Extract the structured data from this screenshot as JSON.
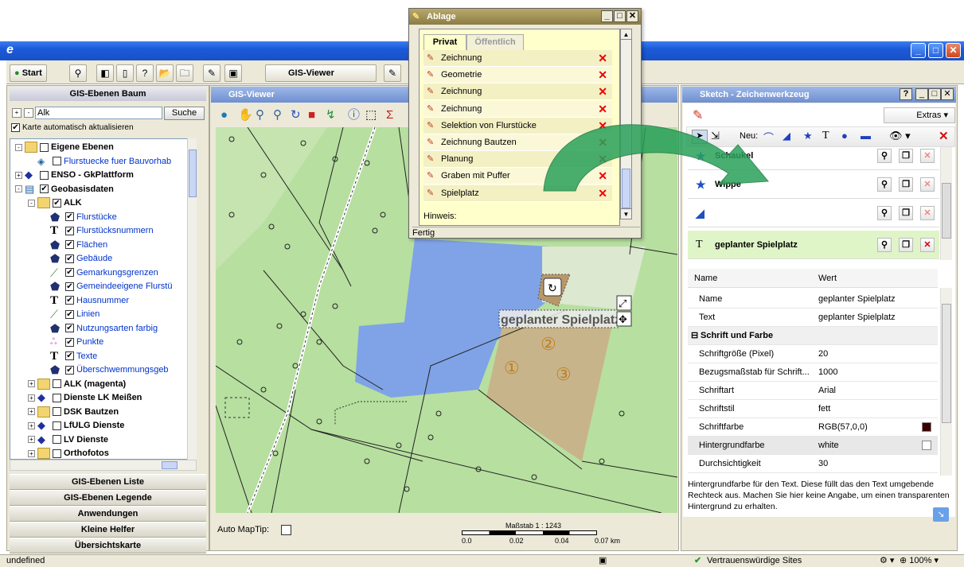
{
  "toolbar": {
    "start_label": "Start",
    "gis_viewer_tab": "GIS-Viewer"
  },
  "left": {
    "title": "GIS-Ebenen Baum",
    "search_value": "Alk",
    "search_button": "Suche",
    "auto_update_label": "Karte automatisch aktualisieren",
    "tree": [
      {
        "label": "Eigene Ebenen",
        "indent": 0,
        "checked": false,
        "bold": true,
        "icon": "folder-icon",
        "exp": "-"
      },
      {
        "label": "Flurstuecke fuer Bauvorhab",
        "indent": 1,
        "checked": false,
        "bold": false,
        "icon": "layer-icon",
        "blue": true
      },
      {
        "label": "ENSO - GkPlattform",
        "indent": 0,
        "checked": false,
        "bold": true,
        "icon": "diamond-icon",
        "exp": "+"
      },
      {
        "label": "Geobasisdaten",
        "indent": 0,
        "checked": true,
        "bold": true,
        "icon": "book-icon",
        "exp": "-"
      },
      {
        "label": "ALK",
        "indent": 1,
        "checked": true,
        "bold": true,
        "icon": "folder-icon",
        "exp": "-"
      },
      {
        "label": "Flurstücke",
        "indent": 2,
        "checked": true,
        "icon": "polygon-icon",
        "blue": true
      },
      {
        "label": "Flurstücksnummern",
        "indent": 2,
        "checked": true,
        "icon": "text-icon",
        "blue": true
      },
      {
        "label": "Flächen",
        "indent": 2,
        "checked": true,
        "icon": "polygon-icon",
        "blue": true
      },
      {
        "label": "Gebäude",
        "indent": 2,
        "checked": true,
        "icon": "polygon-icon",
        "blue": true
      },
      {
        "label": "Gemarkungsgrenzen",
        "indent": 2,
        "checked": true,
        "icon": "line-icon",
        "blue": true
      },
      {
        "label": "Gemeindeeigene Flurstü",
        "indent": 2,
        "checked": true,
        "icon": "polygon-icon",
        "blue": true
      },
      {
        "label": "Hausnummer",
        "indent": 2,
        "checked": true,
        "icon": "text-icon",
        "blue": true
      },
      {
        "label": "Linien",
        "indent": 2,
        "checked": true,
        "icon": "line-icon",
        "blue": true
      },
      {
        "label": "Nutzungsarten farbig",
        "indent": 2,
        "checked": true,
        "icon": "polygon-icon",
        "blue": true
      },
      {
        "label": "Punkte",
        "indent": 2,
        "checked": true,
        "icon": "point-icon",
        "blue": true
      },
      {
        "label": "Texte",
        "indent": 2,
        "checked": true,
        "icon": "text-icon",
        "blue": true
      },
      {
        "label": "Überschwemmungsgeb",
        "indent": 2,
        "checked": true,
        "icon": "polygon-icon",
        "blue": true
      },
      {
        "label": "ALK (magenta)",
        "indent": 1,
        "checked": false,
        "bold": true,
        "icon": "folder-icon",
        "exp": "+"
      },
      {
        "label": "Dienste LK Meißen",
        "indent": 1,
        "checked": false,
        "bold": true,
        "icon": "diamond-icon",
        "exp": "+"
      },
      {
        "label": "DSK Bautzen",
        "indent": 1,
        "checked": false,
        "bold": true,
        "icon": "folder-icon",
        "exp": "+"
      },
      {
        "label": "LfULG Dienste",
        "indent": 1,
        "checked": false,
        "bold": true,
        "icon": "diamond-icon",
        "exp": "+"
      },
      {
        "label": "LV Dienste",
        "indent": 1,
        "checked": false,
        "bold": true,
        "icon": "diamond-icon",
        "exp": "+"
      },
      {
        "label": "Orthofotos",
        "indent": 1,
        "checked": false,
        "bold": true,
        "icon": "folder-icon",
        "exp": "+"
      }
    ],
    "accordions": [
      "GIS-Ebenen Liste",
      "GIS-Ebenen Legende",
      "Anwendungen",
      "Kleine Helfer",
      "Übersichtskarte"
    ]
  },
  "map": {
    "title": "GIS-Viewer",
    "text_label": "geplanter Spielplatz",
    "auto_maptip": "Auto MapTip:",
    "scale_label": "Maßstab 1 : 1243",
    "scale_ticks": [
      "0.0",
      "0.02",
      "0.04",
      "0.07 km"
    ],
    "circled": [
      "①",
      "②",
      "③"
    ]
  },
  "ablage": {
    "title": "Ablage",
    "tabs": [
      "Privat",
      "Öffentlich"
    ],
    "items": [
      "Zeichnung",
      "Geometrie",
      "Zeichnung",
      "Zeichnung",
      "Selektion von Flurstücke",
      "Zeichnung Bautzen",
      "Planung",
      "Graben mit Puffer",
      "Spielplatz"
    ],
    "hinweis": "Hinweis:",
    "status": "Fertig"
  },
  "sketch": {
    "title": "Sketch - Zeichenwerkzeug",
    "extras": "Extras",
    "neu": "Neu:",
    "shapes": [
      {
        "label": "Schaukel",
        "icon": "star-icon"
      },
      {
        "label": "Wippe",
        "icon": "star-icon"
      },
      {
        "label": "",
        "icon": "polygon-icon"
      },
      {
        "label": "geplanter Spielplatz",
        "icon": "text-icon"
      }
    ],
    "prop_headers": [
      "Name",
      "Wert"
    ],
    "props": [
      {
        "name": "Name",
        "value": "geplanter Spielplatz"
      },
      {
        "name": "Text",
        "value": "geplanter Spielplatz"
      }
    ],
    "section": "Schrift und Farbe",
    "props2": [
      {
        "name": "Schriftgröße (Pixel)",
        "value": "20"
      },
      {
        "name": "Bezugsmaßstab für Schrift...",
        "value": "1000"
      },
      {
        "name": "Schriftart",
        "value": "Arial"
      },
      {
        "name": "Schriftstil",
        "value": "fett"
      },
      {
        "name": "Schriftfarbe",
        "value": "RGB(57,0,0)"
      },
      {
        "name": "Hintergrundfarbe",
        "value": "white"
      },
      {
        "name": "Durchsichtigkeit",
        "value": "30"
      }
    ],
    "help": "Hintergrundfarbe für den Text. Diese füllt das den Text umgebende Rechteck aus. Machen Sie hier keine Angabe, um einen transparenten Hintergrund zu erhalten.",
    "swatch_color": "#390000"
  },
  "statusbar": {
    "left": "undefined",
    "zone": "Vertrauenswürdige Sites",
    "zoom": "100%"
  }
}
